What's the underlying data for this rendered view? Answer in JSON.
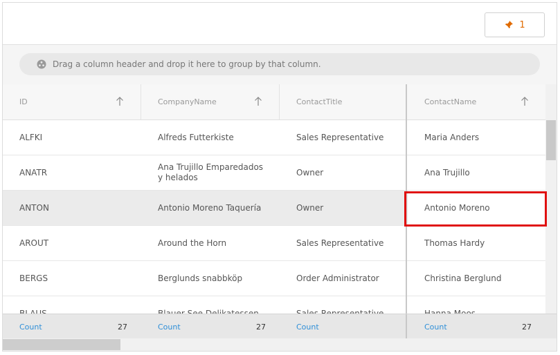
{
  "toolbar": {
    "pinned_count": "1"
  },
  "group_area": {
    "placeholder": "Drag a column header and drop it here to group by that column."
  },
  "columns": [
    {
      "label": "ID",
      "sortable": true
    },
    {
      "label": "CompanyName",
      "sortable": true
    },
    {
      "label": "ContactTitle",
      "sortable": false
    },
    {
      "label": "ContactName",
      "sortable": true
    }
  ],
  "rows": [
    {
      "id": "ALFKI",
      "company": "Alfreds Futterkiste",
      "title": "Sales Representative",
      "contact": "Maria Anders"
    },
    {
      "id": "ANATR",
      "company": "Ana Trujillo Emparedados y helados",
      "title": "Owner",
      "contact": "Ana Trujillo"
    },
    {
      "id": "ANTON",
      "company": "Antonio Moreno Taquería",
      "title": "Owner",
      "contact": "Antonio Moreno"
    },
    {
      "id": "AROUT",
      "company": "Around the Horn",
      "title": "Sales Representative",
      "contact": "Thomas Hardy"
    },
    {
      "id": "BERGS",
      "company": "Berglunds snabbköp",
      "title": "Order Administrator",
      "contact": "Christina Berglund"
    },
    {
      "id": "BLAUS",
      "company": "Blauer See Delikatessen",
      "title": "Sales Representative",
      "contact": "Hanna Moos"
    }
  ],
  "selected_row": 2,
  "summary": [
    {
      "label": "Count",
      "value": "27"
    },
    {
      "label": "Count",
      "value": "27"
    },
    {
      "label": "Count",
      "value": ""
    },
    {
      "label": "Count",
      "value": "27"
    }
  ],
  "colors": {
    "accent": "#e06a00",
    "summary_link": "#2f8fd8",
    "highlight": "#e01010"
  },
  "icons": {
    "pin": "pin-icon",
    "group": "group-icon",
    "sort": "sort-ascending-icon"
  }
}
